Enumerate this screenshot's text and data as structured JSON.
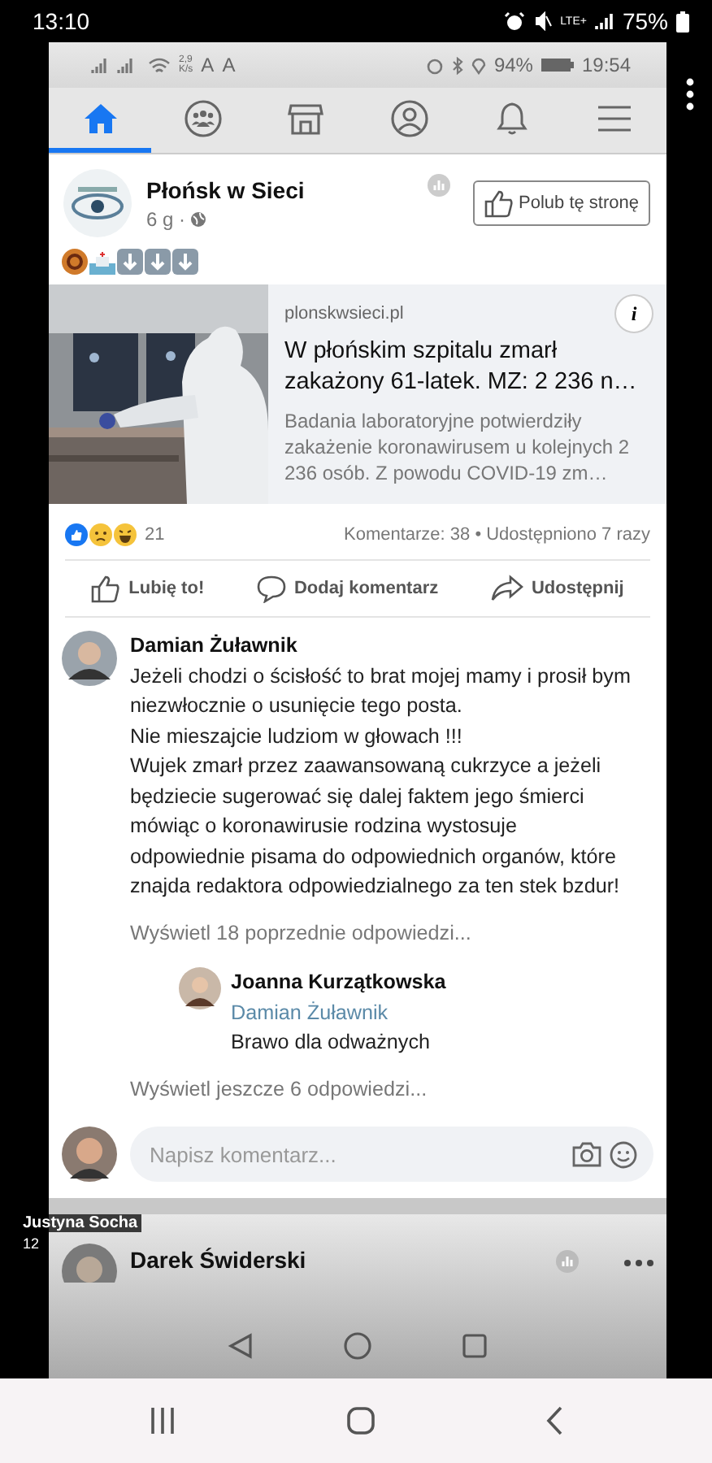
{
  "phone_status_bar": {
    "time": "13:10",
    "network": "LTE+",
    "battery": "75%"
  },
  "screen": {
    "status_bar": {
      "speed_value": "2,9",
      "speed_unit": "K/s",
      "letters": [
        "A",
        "A"
      ],
      "battery": "94%",
      "time": "19:54"
    },
    "tabs": [
      {
        "kind": "home",
        "selected": true
      },
      {
        "kind": "groups",
        "selected": false
      },
      {
        "kind": "marketplace",
        "selected": false
      },
      {
        "kind": "profile",
        "selected": false
      },
      {
        "kind": "notifications",
        "selected": false
      },
      {
        "kind": "menu",
        "selected": false
      }
    ],
    "post": {
      "page_name": "Płońsk w Sieci",
      "age": "6 g ·",
      "like_page_button": "Polub tę stronę",
      "link": {
        "domain": "plonskwsieci.pl",
        "title": "W płońskim szpitalu zmarł zakażony 61-latek. MZ: 2 236 n…",
        "description": "Badania laboratoryjne potwierdziły zakażenie koronawirusem u kolejnych 2 236 osób. Z powodu COVID-19 zm…",
        "info_button": "i"
      },
      "reaction_count": "21",
      "stats": "Komentarze: 38 • Udostępniono 7 razy",
      "actions": [
        {
          "kind": "like",
          "label": "Lubię to!"
        },
        {
          "kind": "comment",
          "label": "Dodaj komentarz"
        },
        {
          "kind": "share",
          "label": "Udostępnij"
        }
      ],
      "comment": {
        "author": "Damian Żuławnik",
        "paragraphs": [
          "Jeżeli chodzi o ścisłość to brat mojej mamy i prosił bym niezwłocznie o usunięcie tego posta.",
          "Nie mieszajcie ludziom w głowach !!!",
          "Wujek zmarł przez zaawansowaną cukrzyce a jeżeli będziecie sugerować się dalej faktem jego śmierci mówiąc o koronawirusie rodzina wystosuje odpowiednie pisama do odpowiednich organów, które znajda redaktora odpowiedzialnego za ten stek bzdur!"
        ]
      },
      "previous_replies": "Wyświetl 18 poprzednie odpowiedzi...",
      "reply": {
        "author": "Joanna Kurzątkowska",
        "mention": "Damian Żuławnik",
        "text": "Brawo dla odważnych"
      },
      "more_replies": "Wyświetl jeszcze 6 odpowiedzi...",
      "comment_field": {
        "placeholder": "Napisz komentarz..."
      }
    },
    "next_post": {
      "author": "Darek Świderski"
    }
  },
  "overlay": {
    "name": "Justyna Socha",
    "time": "12"
  }
}
